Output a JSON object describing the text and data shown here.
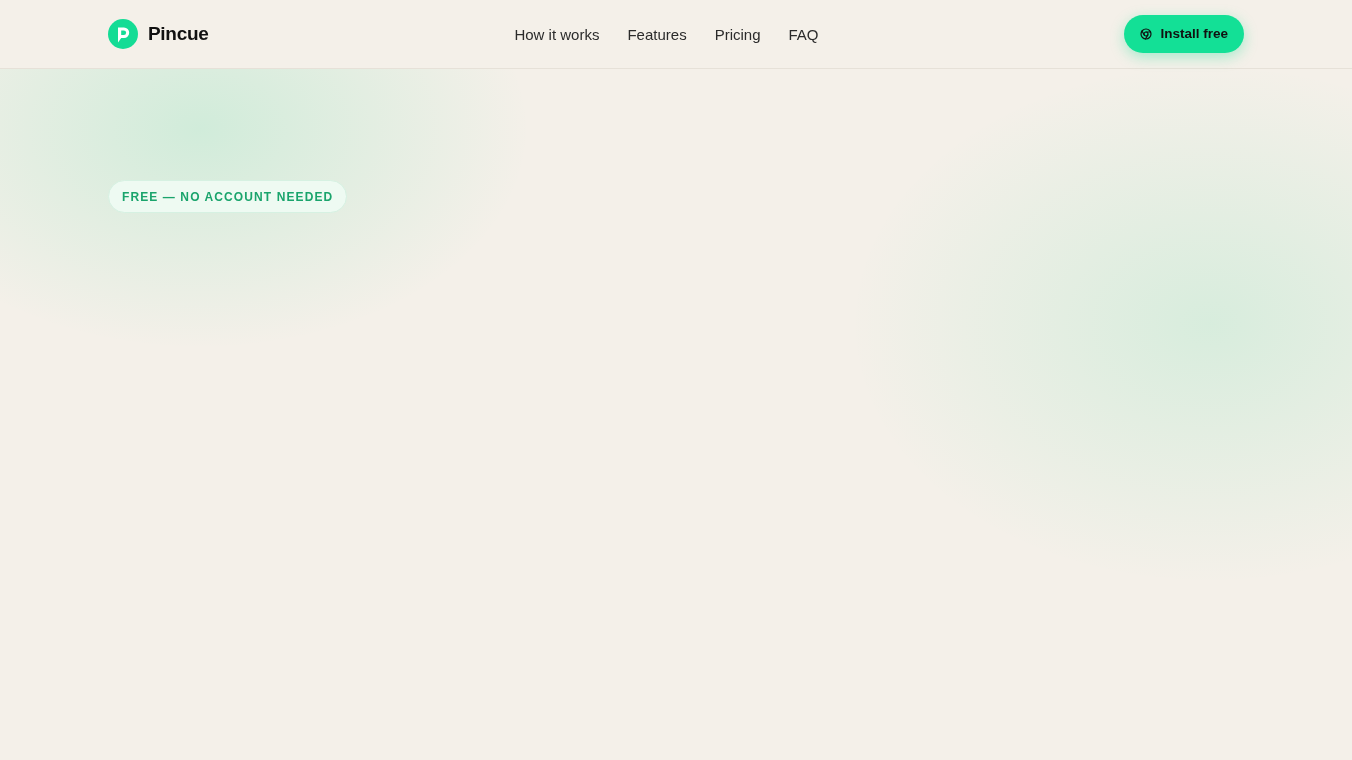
{
  "header": {
    "brand": "Pincue",
    "nav_links": [
      "How it works",
      "Features",
      "Pricing",
      "FAQ"
    ],
    "cta": {
      "label": "Install free"
    }
  },
  "hero": {
    "badge": "FREE — NO ACCOUNT NEEDED"
  }
}
